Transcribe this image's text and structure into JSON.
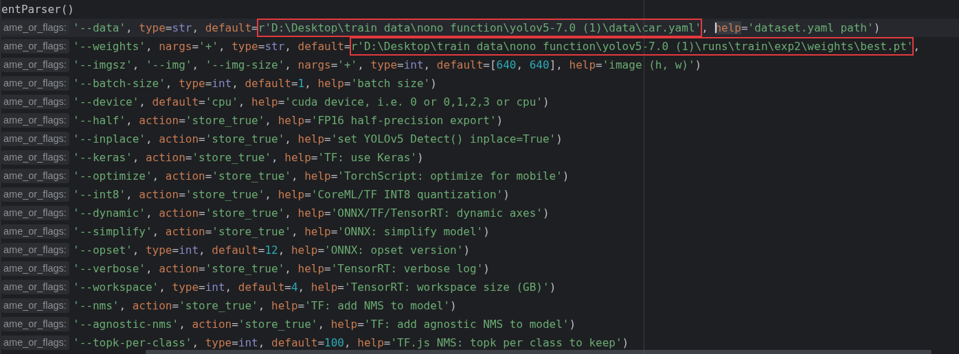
{
  "editor": {
    "header": "entParser()",
    "lines": [
      {
        "hint": "ame_or_flags:",
        "current": true,
        "tokens": [
          {
            "kind": "string",
            "text": "'--data'"
          },
          {
            "kind": "plain",
            "text": ", "
          },
          {
            "kind": "keyword",
            "text": "type"
          },
          {
            "kind": "plain",
            "text": "="
          },
          {
            "kind": "builtin",
            "text": "str"
          },
          {
            "kind": "plain",
            "text": ", "
          },
          {
            "kind": "keyword",
            "text": "default"
          },
          {
            "kind": "plain",
            "text": "="
          },
          {
            "kind": "string",
            "text": "r'D:\\Desktop\\train data\\nono function\\yolov5-7.0 (1)\\data\\car.yaml'",
            "boxed": true
          },
          {
            "kind": "plain",
            "text": ", "
          },
          {
            "kind": "keyword",
            "text": "help",
            "caret": true,
            "highlighted": true
          },
          {
            "kind": "plain",
            "text": "="
          },
          {
            "kind": "string",
            "text": "'dataset.yaml path'"
          },
          {
            "kind": "plain",
            "text": ")"
          }
        ]
      },
      {
        "hint": "ame_or_flags:",
        "current": false,
        "tokens": [
          {
            "kind": "string",
            "text": "'--weights'"
          },
          {
            "kind": "plain",
            "text": ", "
          },
          {
            "kind": "keyword",
            "text": "nargs"
          },
          {
            "kind": "plain",
            "text": "="
          },
          {
            "kind": "string",
            "text": "'+'"
          },
          {
            "kind": "plain",
            "text": ", "
          },
          {
            "kind": "keyword",
            "text": "type"
          },
          {
            "kind": "plain",
            "text": "="
          },
          {
            "kind": "builtin",
            "text": "str"
          },
          {
            "kind": "plain",
            "text": ", "
          },
          {
            "kind": "keyword",
            "text": "default"
          },
          {
            "kind": "plain",
            "text": "="
          },
          {
            "kind": "string",
            "text": "r'D:\\Desktop\\train data\\nono function\\yolov5-7.0 (1)\\runs\\train\\exp2\\weights\\best.pt'",
            "boxed": true
          },
          {
            "kind": "plain",
            "text": ","
          }
        ]
      },
      {
        "hint": "ame_or_flags:",
        "current": false,
        "tokens": [
          {
            "kind": "string",
            "text": "'--imgsz'"
          },
          {
            "kind": "plain",
            "text": ", "
          },
          {
            "kind": "string",
            "text": "'--img'"
          },
          {
            "kind": "plain",
            "text": ", "
          },
          {
            "kind": "string",
            "text": "'--img-size'"
          },
          {
            "kind": "plain",
            "text": ", "
          },
          {
            "kind": "keyword",
            "text": "nargs"
          },
          {
            "kind": "plain",
            "text": "="
          },
          {
            "kind": "string",
            "text": "'+'"
          },
          {
            "kind": "plain",
            "text": ", "
          },
          {
            "kind": "keyword",
            "text": "type"
          },
          {
            "kind": "plain",
            "text": "="
          },
          {
            "kind": "builtin",
            "text": "int"
          },
          {
            "kind": "plain",
            "text": ", "
          },
          {
            "kind": "keyword",
            "text": "default"
          },
          {
            "kind": "plain",
            "text": "=["
          },
          {
            "kind": "number",
            "text": "640"
          },
          {
            "kind": "plain",
            "text": ", "
          },
          {
            "kind": "number",
            "text": "640"
          },
          {
            "kind": "plain",
            "text": "], "
          },
          {
            "kind": "keyword",
            "text": "help"
          },
          {
            "kind": "plain",
            "text": "="
          },
          {
            "kind": "string",
            "text": "'image (h, w)'"
          },
          {
            "kind": "plain",
            "text": ")"
          }
        ]
      },
      {
        "hint": "ame_or_flags:",
        "current": false,
        "tokens": [
          {
            "kind": "string",
            "text": "'--batch-size'"
          },
          {
            "kind": "plain",
            "text": ", "
          },
          {
            "kind": "keyword",
            "text": "type"
          },
          {
            "kind": "plain",
            "text": "="
          },
          {
            "kind": "builtin",
            "text": "int"
          },
          {
            "kind": "plain",
            "text": ", "
          },
          {
            "kind": "keyword",
            "text": "default"
          },
          {
            "kind": "plain",
            "text": "="
          },
          {
            "kind": "number",
            "text": "1"
          },
          {
            "kind": "plain",
            "text": ", "
          },
          {
            "kind": "keyword",
            "text": "help"
          },
          {
            "kind": "plain",
            "text": "="
          },
          {
            "kind": "string",
            "text": "'batch size'"
          },
          {
            "kind": "plain",
            "text": ")"
          }
        ]
      },
      {
        "hint": "ame_or_flags:",
        "current": false,
        "tokens": [
          {
            "kind": "string",
            "text": "'--device'"
          },
          {
            "kind": "plain",
            "text": ", "
          },
          {
            "kind": "keyword",
            "text": "default"
          },
          {
            "kind": "plain",
            "text": "="
          },
          {
            "kind": "string",
            "text": "'cpu'"
          },
          {
            "kind": "plain",
            "text": ", "
          },
          {
            "kind": "keyword",
            "text": "help"
          },
          {
            "kind": "plain",
            "text": "="
          },
          {
            "kind": "string",
            "text": "'cuda device, i.e. 0 or 0,1,2,3 or cpu'"
          },
          {
            "kind": "plain",
            "text": ")"
          }
        ]
      },
      {
        "hint": "ame_or_flags:",
        "current": false,
        "tokens": [
          {
            "kind": "string",
            "text": "'--half'"
          },
          {
            "kind": "plain",
            "text": ", "
          },
          {
            "kind": "keyword",
            "text": "action"
          },
          {
            "kind": "plain",
            "text": "="
          },
          {
            "kind": "string",
            "text": "'store_true'"
          },
          {
            "kind": "plain",
            "text": ", "
          },
          {
            "kind": "keyword",
            "text": "help"
          },
          {
            "kind": "plain",
            "text": "="
          },
          {
            "kind": "string",
            "text": "'FP16 half-precision export'"
          },
          {
            "kind": "plain",
            "text": ")"
          }
        ]
      },
      {
        "hint": "ame_or_flags:",
        "current": false,
        "tokens": [
          {
            "kind": "string",
            "text": "'--inplace'"
          },
          {
            "kind": "plain",
            "text": ", "
          },
          {
            "kind": "keyword",
            "text": "action"
          },
          {
            "kind": "plain",
            "text": "="
          },
          {
            "kind": "string",
            "text": "'store_true'"
          },
          {
            "kind": "plain",
            "text": ", "
          },
          {
            "kind": "keyword",
            "text": "help"
          },
          {
            "kind": "plain",
            "text": "="
          },
          {
            "kind": "string",
            "text": "'set YOLOv5 Detect() inplace=True'"
          },
          {
            "kind": "plain",
            "text": ")"
          }
        ]
      },
      {
        "hint": "ame_or_flags:",
        "current": false,
        "tokens": [
          {
            "kind": "string",
            "text": "'--keras'"
          },
          {
            "kind": "plain",
            "text": ", "
          },
          {
            "kind": "keyword",
            "text": "action"
          },
          {
            "kind": "plain",
            "text": "="
          },
          {
            "kind": "string",
            "text": "'store_true'"
          },
          {
            "kind": "plain",
            "text": ", "
          },
          {
            "kind": "keyword",
            "text": "help"
          },
          {
            "kind": "plain",
            "text": "="
          },
          {
            "kind": "string",
            "text": "'TF: use Keras'"
          },
          {
            "kind": "plain",
            "text": ")"
          }
        ]
      },
      {
        "hint": "ame_or_flags:",
        "current": false,
        "tokens": [
          {
            "kind": "string",
            "text": "'--optimize'"
          },
          {
            "kind": "plain",
            "text": ", "
          },
          {
            "kind": "keyword",
            "text": "action"
          },
          {
            "kind": "plain",
            "text": "="
          },
          {
            "kind": "string",
            "text": "'store_true'"
          },
          {
            "kind": "plain",
            "text": ", "
          },
          {
            "kind": "keyword",
            "text": "help"
          },
          {
            "kind": "plain",
            "text": "="
          },
          {
            "kind": "string",
            "text": "'TorchScript: optimize for mobile'"
          },
          {
            "kind": "plain",
            "text": ")"
          }
        ]
      },
      {
        "hint": "ame_or_flags:",
        "current": false,
        "tokens": [
          {
            "kind": "string",
            "text": "'--int8'"
          },
          {
            "kind": "plain",
            "text": ", "
          },
          {
            "kind": "keyword",
            "text": "action"
          },
          {
            "kind": "plain",
            "text": "="
          },
          {
            "kind": "string",
            "text": "'store_true'"
          },
          {
            "kind": "plain",
            "text": ", "
          },
          {
            "kind": "keyword",
            "text": "help"
          },
          {
            "kind": "plain",
            "text": "="
          },
          {
            "kind": "string",
            "text": "'CoreML/TF INT8 quantization'"
          },
          {
            "kind": "plain",
            "text": ")"
          }
        ]
      },
      {
        "hint": "ame_or_flags:",
        "current": false,
        "tokens": [
          {
            "kind": "string",
            "text": "'--dynamic'"
          },
          {
            "kind": "plain",
            "text": ", "
          },
          {
            "kind": "keyword",
            "text": "action"
          },
          {
            "kind": "plain",
            "text": "="
          },
          {
            "kind": "string",
            "text": "'store_true'"
          },
          {
            "kind": "plain",
            "text": ", "
          },
          {
            "kind": "keyword",
            "text": "help"
          },
          {
            "kind": "plain",
            "text": "="
          },
          {
            "kind": "string",
            "text": "'ONNX/TF/TensorRT: dynamic axes'"
          },
          {
            "kind": "plain",
            "text": ")"
          }
        ]
      },
      {
        "hint": "ame_or_flags:",
        "current": false,
        "tokens": [
          {
            "kind": "string",
            "text": "'--simplify'"
          },
          {
            "kind": "plain",
            "text": ", "
          },
          {
            "kind": "keyword",
            "text": "action"
          },
          {
            "kind": "plain",
            "text": "="
          },
          {
            "kind": "string",
            "text": "'store_true'"
          },
          {
            "kind": "plain",
            "text": ", "
          },
          {
            "kind": "keyword",
            "text": "help"
          },
          {
            "kind": "plain",
            "text": "="
          },
          {
            "kind": "string",
            "text": "'ONNX: simplify model'"
          },
          {
            "kind": "plain",
            "text": ")"
          }
        ]
      },
      {
        "hint": "ame_or_flags:",
        "current": false,
        "tokens": [
          {
            "kind": "string",
            "text": "'--opset'"
          },
          {
            "kind": "plain",
            "text": ", "
          },
          {
            "kind": "keyword",
            "text": "type"
          },
          {
            "kind": "plain",
            "text": "="
          },
          {
            "kind": "builtin",
            "text": "int"
          },
          {
            "kind": "plain",
            "text": ", "
          },
          {
            "kind": "keyword",
            "text": "default"
          },
          {
            "kind": "plain",
            "text": "="
          },
          {
            "kind": "number",
            "text": "12"
          },
          {
            "kind": "plain",
            "text": ", "
          },
          {
            "kind": "keyword",
            "text": "help"
          },
          {
            "kind": "plain",
            "text": "="
          },
          {
            "kind": "string",
            "text": "'ONNX: opset version'"
          },
          {
            "kind": "plain",
            "text": ")"
          }
        ]
      },
      {
        "hint": "ame_or_flags:",
        "current": false,
        "tokens": [
          {
            "kind": "string",
            "text": "'--verbose'"
          },
          {
            "kind": "plain",
            "text": ", "
          },
          {
            "kind": "keyword",
            "text": "action"
          },
          {
            "kind": "plain",
            "text": "="
          },
          {
            "kind": "string",
            "text": "'store_true'"
          },
          {
            "kind": "plain",
            "text": ", "
          },
          {
            "kind": "keyword",
            "text": "help"
          },
          {
            "kind": "plain",
            "text": "="
          },
          {
            "kind": "string",
            "text": "'TensorRT: verbose log'"
          },
          {
            "kind": "plain",
            "text": ")"
          }
        ]
      },
      {
        "hint": "ame_or_flags:",
        "current": false,
        "tokens": [
          {
            "kind": "string",
            "text": "'--workspace'"
          },
          {
            "kind": "plain",
            "text": ", "
          },
          {
            "kind": "keyword",
            "text": "type"
          },
          {
            "kind": "plain",
            "text": "="
          },
          {
            "kind": "builtin",
            "text": "int"
          },
          {
            "kind": "plain",
            "text": ", "
          },
          {
            "kind": "keyword",
            "text": "default"
          },
          {
            "kind": "plain",
            "text": "="
          },
          {
            "kind": "number",
            "text": "4"
          },
          {
            "kind": "plain",
            "text": ", "
          },
          {
            "kind": "keyword",
            "text": "help"
          },
          {
            "kind": "plain",
            "text": "="
          },
          {
            "kind": "string",
            "text": "'TensorRT: workspace size (GB)'"
          },
          {
            "kind": "plain",
            "text": ")"
          }
        ]
      },
      {
        "hint": "ame_or_flags:",
        "current": false,
        "tokens": [
          {
            "kind": "string",
            "text": "'--nms'"
          },
          {
            "kind": "plain",
            "text": ", "
          },
          {
            "kind": "keyword",
            "text": "action"
          },
          {
            "kind": "plain",
            "text": "="
          },
          {
            "kind": "string",
            "text": "'store_true'"
          },
          {
            "kind": "plain",
            "text": ", "
          },
          {
            "kind": "keyword",
            "text": "help"
          },
          {
            "kind": "plain",
            "text": "="
          },
          {
            "kind": "string",
            "text": "'TF: add NMS to model'"
          },
          {
            "kind": "plain",
            "text": ")"
          }
        ]
      },
      {
        "hint": "ame_or_flags:",
        "current": false,
        "tokens": [
          {
            "kind": "string",
            "text": "'--agnostic-nms'"
          },
          {
            "kind": "plain",
            "text": ", "
          },
          {
            "kind": "keyword",
            "text": "action"
          },
          {
            "kind": "plain",
            "text": "="
          },
          {
            "kind": "string",
            "text": "'store_true'"
          },
          {
            "kind": "plain",
            "text": ", "
          },
          {
            "kind": "keyword",
            "text": "help"
          },
          {
            "kind": "plain",
            "text": "="
          },
          {
            "kind": "string",
            "text": "'TF: add agnostic NMS to model'"
          },
          {
            "kind": "plain",
            "text": ")"
          }
        ]
      },
      {
        "hint": "ame_or_flags:",
        "current": false,
        "tokens": [
          {
            "kind": "string",
            "text": "'--topk-per-class'"
          },
          {
            "kind": "plain",
            "text": ", "
          },
          {
            "kind": "keyword",
            "text": "type"
          },
          {
            "kind": "plain",
            "text": "="
          },
          {
            "kind": "builtin",
            "text": "int"
          },
          {
            "kind": "plain",
            "text": ", "
          },
          {
            "kind": "keyword",
            "text": "default"
          },
          {
            "kind": "plain",
            "text": "="
          },
          {
            "kind": "number",
            "text": "100"
          },
          {
            "kind": "plain",
            "text": ", "
          },
          {
            "kind": "keyword",
            "text": "help"
          },
          {
            "kind": "plain",
            "text": "="
          },
          {
            "kind": "string",
            "text": "'TF.js NMS: topk per class to keep'"
          },
          {
            "kind": "plain",
            "text": ")"
          }
        ]
      }
    ]
  }
}
